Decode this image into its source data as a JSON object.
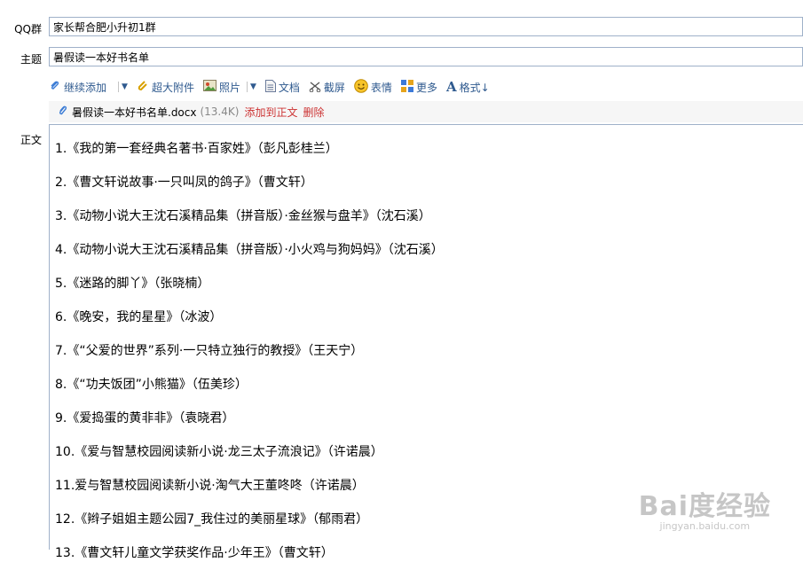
{
  "form": {
    "qq_label": "QQ群",
    "qq_value": "家长帮合肥小升初1群",
    "subject_label": "主题",
    "subject_value": "暑假读一本好书名单",
    "body_label": "正文"
  },
  "toolbar": {
    "items": [
      {
        "label": "继续添加",
        "icon": "paperclip-icon"
      },
      {
        "label": "超大附件",
        "icon": "large-attachment-icon"
      },
      {
        "label": "照片",
        "icon": "photo-icon"
      },
      {
        "label": "文档",
        "icon": "document-icon"
      },
      {
        "label": "截屏",
        "icon": "screenshot-icon"
      },
      {
        "label": "表情",
        "icon": "emoticon-icon"
      },
      {
        "label": "更多",
        "icon": "more-icon"
      },
      {
        "label": "格式↓",
        "icon": "format-icon"
      }
    ]
  },
  "attachment": {
    "name": "暑假读一本好书名单.docx",
    "size": "(13.4K)",
    "add_to_body": "添加到正文",
    "delete": "删除"
  },
  "body_lines": [
    "1.《我的第一套经典名著书·百家姓》（彭凡彭桂兰）",
    "2.《曹文轩说故事·一只叫凤的鸽子》（曹文轩）",
    "3.《动物小说大王沈石溪精品集（拼音版）·金丝猴与盘羊》（沈石溪）",
    "4.《动物小说大王沈石溪精品集（拼音版）·小火鸡与狗妈妈》（沈石溪）",
    "5.《迷路的脚丫》（张晓楠）",
    "6.《晚安，我的星星》（冰波）",
    "7.《“父爱的世界”系列·一只特立独行的教授》（王天宁）",
    "8.《“功夫饭团”小熊猫》（伍美珍）",
    "9.《爱捣蛋的黄非非》（袁晓君）",
    "10.《爱与智慧校园阅读新小说·龙三太子流浪记》（许诺晨）",
    "11.爱与智慧校园阅读新小说·淘气大王董咚咚（许诺晨）",
    "12.《辫子姐姐主题公园7_我住过的美丽星球》（郁雨君）",
    "13.《曹文轩儿童文学获奖作品·少年王》（曹文轩）"
  ],
  "watermark": {
    "main": "Bai度经验",
    "sub": "jingyan.baidu.com"
  },
  "colors": {
    "toolbar_text": "#2f5a8f",
    "link_red": "#cc3333",
    "field_border": "#9fb1c9"
  }
}
